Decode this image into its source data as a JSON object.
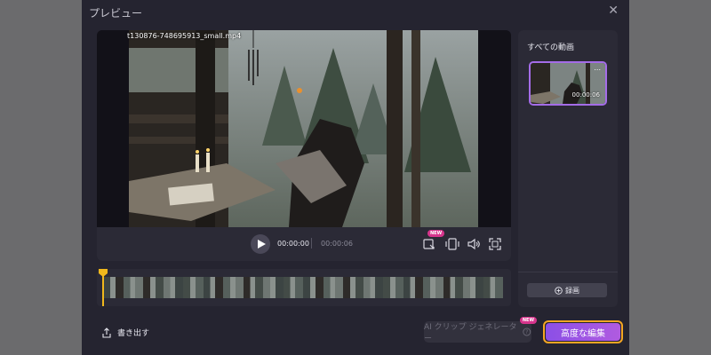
{
  "dialog": {
    "title": "プレビュー",
    "close_icon": "close-icon"
  },
  "player": {
    "filename": "t130876-748695913_small.mp4",
    "current_time": "00:00:00",
    "total_time": "00:00:06",
    "new_badge": "NEW"
  },
  "sidebar": {
    "title": "すべての動画",
    "thumb_duration": "00:00:06",
    "thumb_more": "...",
    "record_label": "録画"
  },
  "footer": {
    "export_label": "書き出す",
    "ai_button_label": "AI クリップ ジェネレーター",
    "ai_new_badge": "NEW",
    "advanced_button_label": "高度な編集"
  },
  "colors": {
    "accent": "#a46ce8",
    "playhead": "#f0b81c",
    "highlight": "#f5a623",
    "badge": "#d6348c"
  }
}
